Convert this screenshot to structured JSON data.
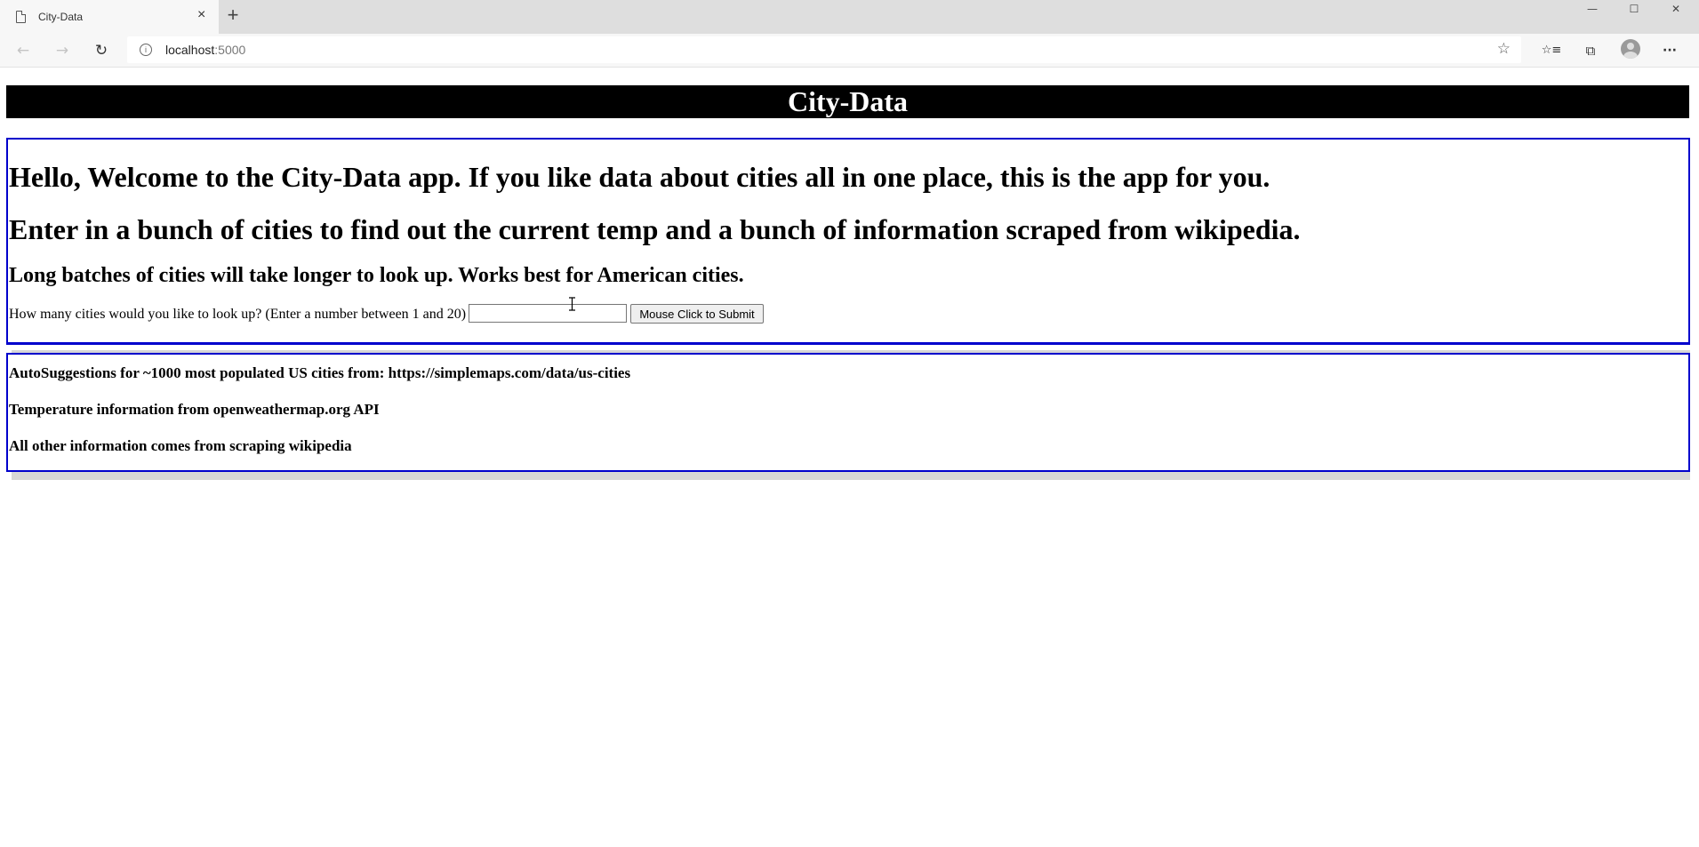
{
  "browser": {
    "tab_title": "City-Data",
    "tab_close": "×",
    "new_tab": "+",
    "url_host": "localhost",
    "url_port": ":5000",
    "info": "i",
    "star": "☆",
    "back": "←",
    "forward": "→",
    "reload": "↻",
    "favorites": "☆≡",
    "collections": "⧉",
    "more": "···",
    "minimize": "—",
    "maximize": "☐",
    "close": "✕"
  },
  "page": {
    "header": "City-Data",
    "welcome": "Hello, Welcome to the City-Data app. If you like data about cities all in one place, this is the app for you.",
    "instructions": "Enter in a bunch of cities to find out the current temp and a bunch of information scraped from wikipedia.",
    "note": "Long batches of cities will take longer to look up. Works best for American cities.",
    "prompt": "How many cities would you like to look up? (Enter a number between 1 and 20)",
    "input_value": "",
    "submit_label": "Mouse Click to Submit"
  },
  "credits": [
    "AutoSuggestions for ~1000 most populated US cities from: https://simplemaps.com/data/us-cities",
    "Temperature information from openweathermap.org API",
    "All other information comes from scraping wikipedia"
  ],
  "colors": {
    "header_bg": "#000000",
    "header_text": "#ffffff",
    "box_border": "#0000cc",
    "shadow": "#d6d6d6"
  }
}
